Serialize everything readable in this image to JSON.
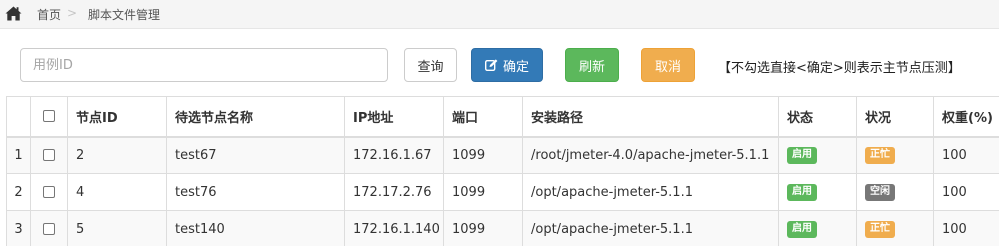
{
  "breadcrumb": {
    "home_icon": "home-icon",
    "items": [
      "首页",
      "脚本文件管理"
    ],
    "separator": ">"
  },
  "toolbar": {
    "search_placeholder": "用例ID",
    "query_label": "查询",
    "ok_label": "确定",
    "ok_icon": "edit-icon",
    "refresh_label": "刷新",
    "cancel_label": "取消",
    "hint": "【不勾选直接<确定>则表示主节点压测】"
  },
  "colors": {
    "primary": "#337ab7",
    "success": "#5cb85c",
    "warning": "#f0ad4e",
    "muted": "#777777"
  },
  "table": {
    "headers": [
      "节点ID",
      "待选节点名称",
      "IP地址",
      "端口",
      "安装路径",
      "状态",
      "状况",
      "权重(%)"
    ],
    "rows": [
      {
        "num": "1",
        "id": "2",
        "name": "test67",
        "ip": "172.16.1.67",
        "port": "1099",
        "path": "/root/jmeter-4.0/apache-jmeter-5.1.1",
        "status": "启用",
        "status_color": "green",
        "condition": "正忙",
        "condition_color": "orange",
        "weight": "100"
      },
      {
        "num": "2",
        "id": "4",
        "name": "test76",
        "ip": "172.17.2.76",
        "port": "1099",
        "path": "/opt/apache-jmeter-5.1.1",
        "status": "启用",
        "status_color": "green",
        "condition": "空闲",
        "condition_color": "grey",
        "weight": "100"
      },
      {
        "num": "3",
        "id": "5",
        "name": "test140",
        "ip": "172.16.1.140",
        "port": "1099",
        "path": "/opt/apache-jmeter-5.1.1",
        "status": "启用",
        "status_color": "green",
        "condition": "正忙",
        "condition_color": "orange",
        "weight": "100"
      }
    ]
  }
}
